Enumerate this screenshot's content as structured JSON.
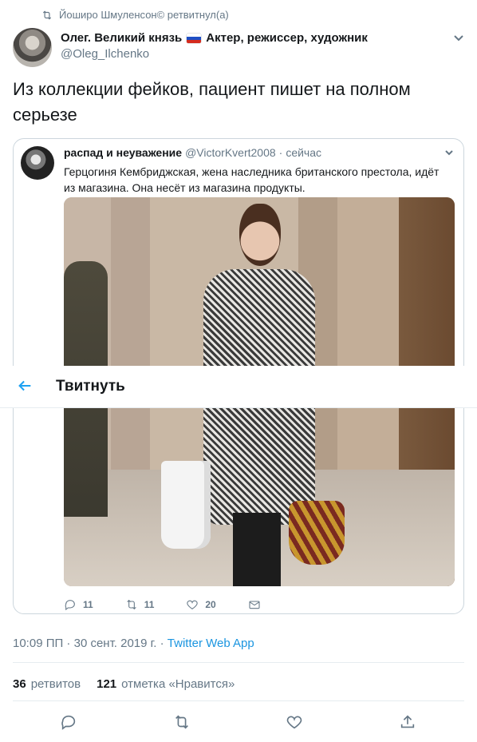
{
  "retweet_banner": "Йоширо Шмуленсон© ретвитнул(а)",
  "author": {
    "name_part1": "Олег. Великий князь",
    "name_part2": "Актер, режиссер, художник",
    "handle": "@Oleg_Ilchenko"
  },
  "tweet_text": "Из коллекции фейков, пациент пишет на полном серьезе",
  "quoted_tweet": {
    "name": "распад и неуважение",
    "handle": "@VictorKvert2008",
    "separator": "·",
    "time": "сейчас",
    "text": "Герцогиня Кембриджская, жена наследника британского престола, идёт из магазина. Она несёт из магазина продукты.",
    "reply_count": "11",
    "retweet_count": "11",
    "like_count": "20"
  },
  "header_bar": {
    "title": "Твитнуть"
  },
  "meta": {
    "timestamp": "10:09 ПП · 30 сент. 2019 г. · ",
    "source": "Twitter Web App"
  },
  "stats": {
    "retweets_count": "36",
    "retweets_label": "ретвитов",
    "likes_count": "121",
    "likes_label": "отметка «Нравится»"
  },
  "icons": {
    "retweet_banner": "retweet-icon",
    "back": "arrow-left-icon",
    "reply": "reply-icon",
    "retweet": "retweet-icon",
    "like": "heart-icon",
    "share": "share-icon",
    "dm": "envelope-icon"
  },
  "colors": {
    "accent": "#1da1f2",
    "link": "#1b95e0",
    "muted": "#657786",
    "text": "#14171a",
    "border": "#ccd6dd"
  }
}
